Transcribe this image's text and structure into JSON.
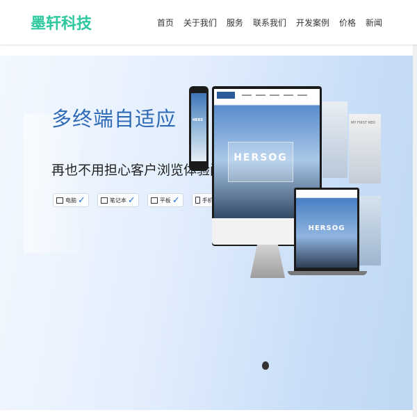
{
  "header": {
    "logo": "墨轩科技",
    "nav": [
      "首页",
      "关于我们",
      "服务",
      "联系我们",
      "开发案例",
      "价格",
      "新闻"
    ]
  },
  "hero": {
    "title": "多终端自适应",
    "subtitle": "再也不用担心客户浏览体验问题",
    "devices": [
      {
        "label": "电脑",
        "icon": "monitor-icon"
      },
      {
        "label": "笔记本",
        "icon": "laptop-icon"
      },
      {
        "label": "平板",
        "icon": "tablet-icon"
      },
      {
        "label": "手机",
        "icon": "phone-icon"
      }
    ],
    "mockup_brand": "HERSOG",
    "mockup_phone_brand": "HERS",
    "mockup_card_text": "MY FIRST RED"
  },
  "colors": {
    "logo": "#2ec8a0",
    "title": "#2f6ab6",
    "check": "#1f6fd6"
  }
}
